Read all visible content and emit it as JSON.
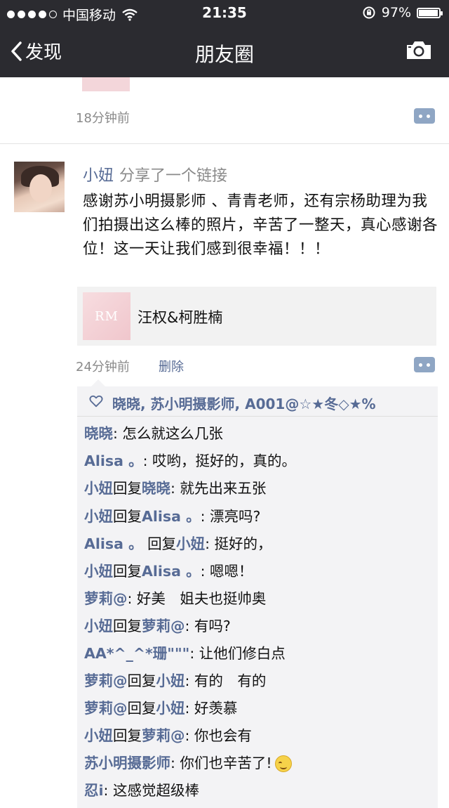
{
  "status_bar": {
    "carrier": "中国移动",
    "time": "21:35",
    "battery": "97%",
    "battery_level": 0.97
  },
  "nav": {
    "back_label": "发现",
    "title": "朋友圈"
  },
  "prev_post": {
    "time": "18分钟前"
  },
  "post": {
    "author": "小妞",
    "action": "分享了一个链接",
    "text": "感谢苏小明摄影师 、青青老师，还有宗杨助理为我们拍摄出这么棒的照片，辛苦了一整天，真心感谢各位！这一天让我们感到很幸福！！！",
    "link": {
      "thumb_text": "RM",
      "title": "汪权&柯胜楠"
    },
    "time": "24分钟前",
    "delete_label": "删除"
  },
  "likes": "晓晓, 苏小明摄影师, A001@☆★冬◇★%",
  "comments": [
    {
      "name": "晓晓",
      "text": ": 怎么就这么几张"
    },
    {
      "name": "Alisa 。",
      "text": ": 哎哟，挺好的，真的。"
    },
    {
      "name": "小妞",
      "mid": "回复",
      "target": "晓晓",
      "text": ": 就先出来五张"
    },
    {
      "name": "小妞",
      "mid": "回复",
      "target": "Alisa 。",
      "text": ": 漂亮吗?"
    },
    {
      "name": "Alisa 。",
      "mid": " 回复",
      "target": "小妞",
      "text": ": 挺好的，"
    },
    {
      "name": "小妞",
      "mid": "回复",
      "target": "Alisa 。",
      "text": ": 嗯嗯！"
    },
    {
      "name": "萝莉@",
      "text": ": 好美　姐夫也挺帅奥"
    },
    {
      "name": "小妞",
      "mid": "回复",
      "target": "萝莉@",
      "text": ": 有吗?"
    },
    {
      "name": "AA*^_^*珊\"\"\"",
      "text": ": 让他们修白点"
    },
    {
      "name": "萝莉@",
      "mid": "回复",
      "target": "小妞",
      "text": ": 有的　有的"
    },
    {
      "name": "萝莉@",
      "mid": "回复",
      "target": "小妞",
      "text": ": 好羡慕"
    },
    {
      "name": "小妞",
      "mid": "回复",
      "target": "萝莉@",
      "text": ": 你也会有"
    },
    {
      "name": "苏小明摄影师",
      "text": ": 你们也辛苦了!"
    },
    {
      "name": "忍i",
      "text": ": 这感觉超级棒"
    }
  ]
}
